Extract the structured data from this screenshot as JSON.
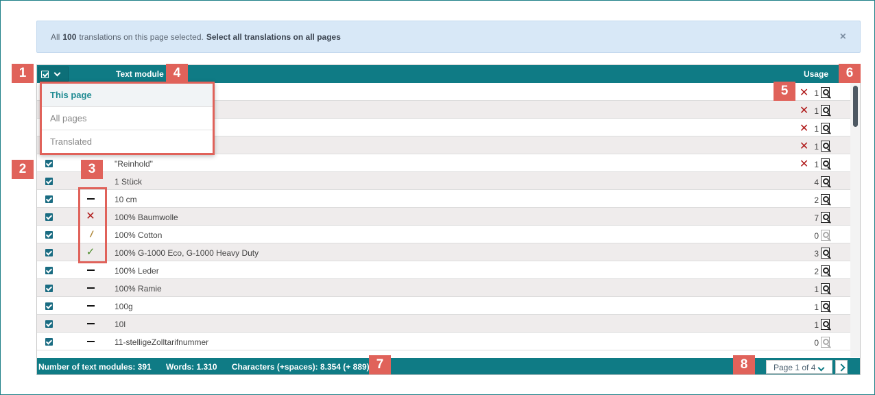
{
  "banner": {
    "prefix": "All",
    "count": "100",
    "middle": "translations on this page selected.",
    "link": "Select all translations on all pages",
    "close": "×"
  },
  "header": {
    "text_module": "Text module",
    "usage": "Usage"
  },
  "dropdown": {
    "options": [
      "This page",
      "All pages",
      "Translated"
    ]
  },
  "rows": [
    {
      "status": "",
      "text": "",
      "usage": "1",
      "unused_x": true
    },
    {
      "status": "",
      "text": "",
      "usage": "1",
      "unused_x": true
    },
    {
      "status": "",
      "text": "",
      "usage": "1",
      "unused_x": true
    },
    {
      "status": "",
      "text": "",
      "usage": "1",
      "unused_x": true
    },
    {
      "status": "",
      "text": "\"Reinhold\"",
      "usage": "1",
      "unused_x": true
    },
    {
      "status": "",
      "text": "1 Stück",
      "usage": "4",
      "unused_x": false
    },
    {
      "status": "dash",
      "text": "10 cm",
      "usage": "2",
      "unused_x": false
    },
    {
      "status": "cross",
      "text": "100% Baumwolle",
      "usage": "7",
      "unused_x": false
    },
    {
      "status": "slash",
      "text": "100% Cotton",
      "usage": "0",
      "unused_x": false
    },
    {
      "status": "check",
      "text": "100% G-1000 Eco, G-1000 Heavy Duty",
      "usage": "3",
      "unused_x": false
    },
    {
      "status": "dash",
      "text": "100% Leder",
      "usage": "2",
      "unused_x": false
    },
    {
      "status": "dash",
      "text": "100% Ramie",
      "usage": "1",
      "unused_x": false
    },
    {
      "status": "dash",
      "text": "100g",
      "usage": "1",
      "unused_x": false
    },
    {
      "status": "dash",
      "text": "10l",
      "usage": "1",
      "unused_x": false
    },
    {
      "status": "dash",
      "text": "11-stelligeZolltarifnummer",
      "usage": "0",
      "unused_x": false
    }
  ],
  "footer": {
    "modules": "Number of text modules: 391",
    "words": "Words: 1.310",
    "characters": "Characters (+spaces): 8.354 (+ 889)",
    "pager": "Page 1 of 4"
  },
  "callouts": [
    "1",
    "2",
    "3",
    "4",
    "5",
    "6",
    "7",
    "8"
  ],
  "colors": {
    "header_teal": "#0f7b85",
    "callout_red": "#e0625a",
    "banner_blue": "#d8e8f7"
  }
}
